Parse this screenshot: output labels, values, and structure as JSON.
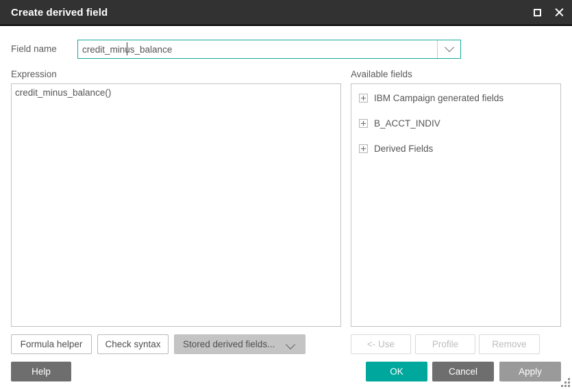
{
  "window": {
    "title": "Create derived field",
    "controls": {
      "maximize": "Maximize",
      "close": "Close"
    }
  },
  "field_name": {
    "label": "Field name",
    "value": "credit_minus_balance",
    "placeholder": "",
    "dropdown_icon": "chevron-down-icon"
  },
  "expression": {
    "label": "Expression",
    "value": "credit_minus_balance()"
  },
  "available_fields": {
    "label": "Available fields",
    "nodes": [
      {
        "label": "IBM Campaign generated fields",
        "expander": "plus-box-icon"
      },
      {
        "label": "B_ACCT_INDIV",
        "expander": "plus-box-icon"
      },
      {
        "label": "Derived Fields",
        "expander": "plus-box-icon"
      }
    ]
  },
  "left_buttons": {
    "formula_helper": "Formula helper",
    "check_syntax": "Check syntax",
    "stored_derived_fields": "Stored derived fields...",
    "help": "Help"
  },
  "right_buttons": {
    "use": "<- Use",
    "profile": "Profile",
    "remove": "Remove"
  },
  "actions": {
    "ok": "OK",
    "cancel": "Cancel",
    "apply": "Apply"
  },
  "colors": {
    "titlebar": "#323232",
    "accent_teal": "#00a79d",
    "focus_border": "#14a89c",
    "button_dark_gray": "#6e6e6e",
    "button_mid_gray": "#9a9a9a",
    "button_light_gray": "#c4c4c4",
    "disabled_text": "#bdbdbd",
    "body_text": "#555555",
    "panel_border": "#c2c2c2"
  }
}
